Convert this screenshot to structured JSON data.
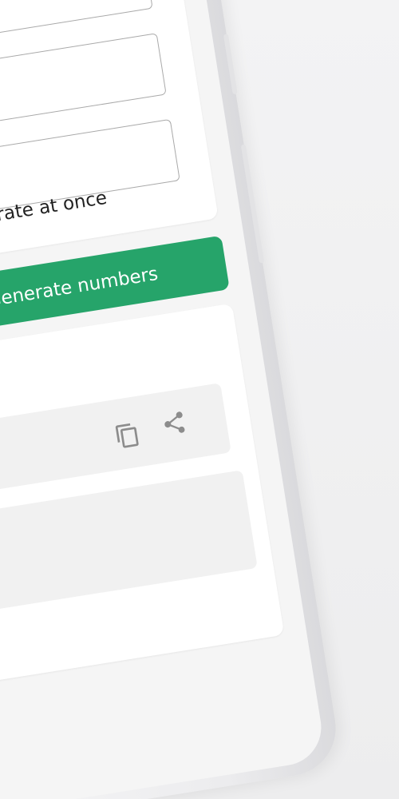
{
  "form": {
    "checkbox_label": "Generate all numbers to generate at once"
  },
  "actions": {
    "generate_label": "Generate numbers"
  },
  "results": {
    "copy_icon": "copy-icon",
    "share_icon": "share-icon"
  }
}
